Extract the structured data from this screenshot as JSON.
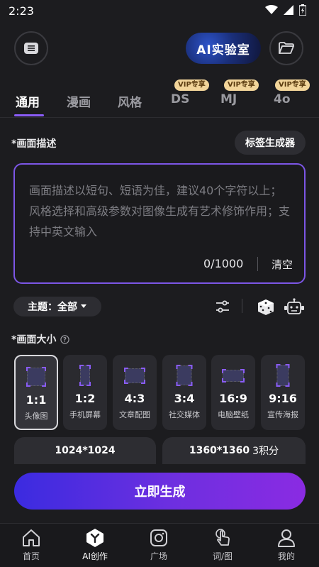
{
  "status_bar": {
    "time": "2:23"
  },
  "header": {
    "title": "AI实验室"
  },
  "tabs": [
    {
      "label": "通用",
      "vip": ""
    },
    {
      "label": "漫画",
      "vip": ""
    },
    {
      "label": "风格",
      "vip": ""
    },
    {
      "label": "DS",
      "vip": "VIP专享"
    },
    {
      "label": "MJ",
      "vip": "VIP专享"
    },
    {
      "label": "4o",
      "vip": "VIP专享"
    }
  ],
  "description": {
    "label": "*画面描述",
    "tag_button": "标签生成器",
    "placeholder": "画面描述以短句、短语为佳，建议40个字符以上；风格选择和高级参数对图像生成有艺术修饰作用；支持中英文输入",
    "count": "0/1000",
    "clear": "清空"
  },
  "theme": {
    "label": "主题：全部"
  },
  "size": {
    "label": "*画面大小",
    "ratios": [
      {
        "value": "1:1",
        "name": "头像图"
      },
      {
        "value": "1:2",
        "name": "手机屏幕"
      },
      {
        "value": "4:3",
        "name": "文章配图"
      },
      {
        "value": "3:4",
        "name": "社交媒体"
      },
      {
        "value": "16:9",
        "name": "电脑壁纸"
      },
      {
        "value": "9:16",
        "name": "宣传海报"
      }
    ],
    "resolutions": [
      {
        "text": "1024*1024"
      },
      {
        "text": "1360*1360",
        "extra": "3积分"
      }
    ]
  },
  "generate_button": "立即生成",
  "bottom_nav": [
    {
      "label": "首页",
      "icon": "home-icon"
    },
    {
      "label": "AI创作",
      "icon": "ai-create-icon"
    },
    {
      "label": "广场",
      "icon": "square-icon"
    },
    {
      "label": "词/图",
      "icon": "touch-icon"
    },
    {
      "label": "我的",
      "icon": "user-icon"
    }
  ],
  "colors": {
    "accent": "#8a5cf6",
    "vip_badge": "#f2d59a",
    "background": "#1c1c1f"
  }
}
